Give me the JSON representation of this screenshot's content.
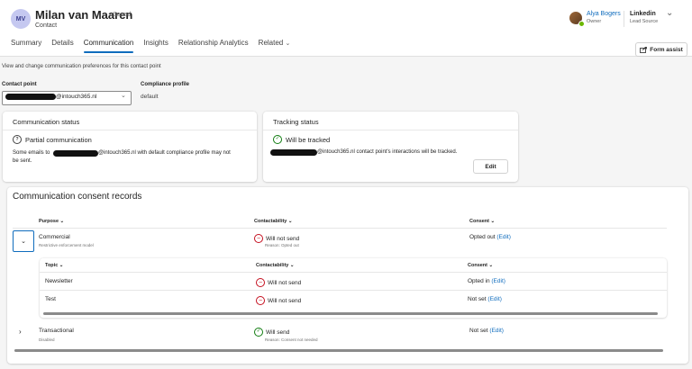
{
  "header": {
    "avatar_initials": "MV",
    "name": "Milan van Maaren",
    "saved_status": "- Saved",
    "record_type": "Contact",
    "tabs": [
      {
        "label": "Summary"
      },
      {
        "label": "Details"
      },
      {
        "label": "Communication",
        "active": true
      },
      {
        "label": "Insights"
      },
      {
        "label": "Relationship Analytics"
      },
      {
        "label": "Related"
      }
    ],
    "owner_name": "Alya Bogers",
    "owner_label": "Owner",
    "lead_source_value": "Linkedin",
    "lead_source_label": "Lead Source",
    "form_assist": "Form assist"
  },
  "page": {
    "description": "View and change communication preferences for this contact point",
    "contact_point_label": "Contact point",
    "contact_point_value": "@intouch365.nl",
    "compliance_label": "Compliance profile",
    "compliance_value": "default"
  },
  "communication_status": {
    "title": "Communication status",
    "status": "Partial communication",
    "detail_prefix": "Some emails to",
    "detail_suffix": "@intouch365.nl with default compliance profile may not",
    "detail_line2": "be sent."
  },
  "tracking_status": {
    "title": "Tracking status",
    "status": "Will be tracked",
    "detail_suffix": "@intouch365.nl contact point's interactions will be tracked.",
    "edit_label": "Edit"
  },
  "consent": {
    "title": "Communication consent records",
    "headers": {
      "purpose": "Purpose",
      "contactability": "Contactability",
      "consent": "Consent"
    },
    "rows": [
      {
        "purpose": "Commercial",
        "purpose_sub": "Restrictive enforcement model",
        "contactability": "Will not send",
        "contactability_sub": "Reason: Opted out",
        "consent": "Opted out",
        "edit": "(Edit)",
        "expanded": true
      },
      {
        "purpose": "Transactional",
        "purpose_sub": "Disabled",
        "contactability": "Will send",
        "contactability_sub": "Reason: Consent not needed",
        "consent": "Not set",
        "edit": "(Edit)",
        "expanded": false
      }
    ],
    "topics": {
      "headers": {
        "topic": "Topic",
        "contactability": "Contactability",
        "consent": "Consent"
      },
      "rows": [
        {
          "topic": "Newsletter",
          "contactability": "Will not send",
          "consent": "Opted in",
          "edit": "(Edit)"
        },
        {
          "topic": "Test",
          "contactability": "Will not send",
          "consent": "Not set",
          "edit": "(Edit)"
        }
      ]
    }
  },
  "colors": {
    "accent": "#0f6cbd",
    "success": "#107c10",
    "danger": "#c50f1f"
  },
  "icons": [
    "chevron-down-icon",
    "chevron-right-icon",
    "question-circle-icon",
    "checkmark-circle-icon",
    "block-icon",
    "form-assist-icon"
  ]
}
